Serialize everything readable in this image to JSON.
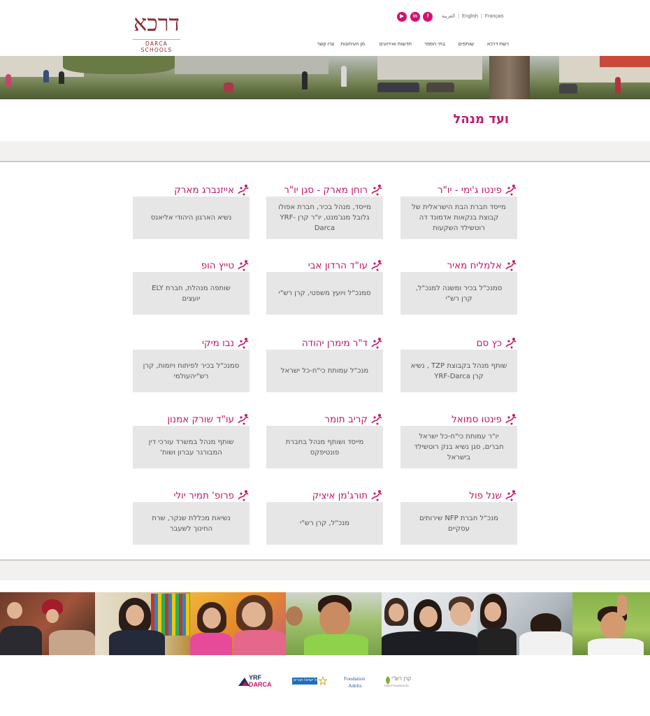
{
  "header": {
    "logo_hebrew": "דרכא",
    "logo_english": "DARCA SCHOOLS",
    "socials": [
      {
        "icon": "youtube-icon",
        "glyph": "▶"
      },
      {
        "icon": "linkedin-icon",
        "glyph": "in"
      },
      {
        "icon": "facebook-icon",
        "glyph": "f"
      }
    ],
    "languages": [
      "العربية",
      "English",
      "Français"
    ],
    "nav": [
      "רשת דרכא",
      "שותפים",
      "בתי הספר",
      "חדשות ואירועים",
      "מן העיתונות",
      "צרו קשר"
    ]
  },
  "page_title": "ועד מנהל",
  "colors": {
    "accent": "#c2186a",
    "card": "#e6e6e6",
    "band": "#f3f0f0"
  },
  "members": [
    {
      "name": "פינטו ג'ימי - יו\"ר",
      "desc": "מייסד חברת הבת הישראלית של קבוצת בנקאות אדמונד דה רוטשילד השקעות"
    },
    {
      "name": "רוחן מארק - סגן יו\"ר",
      "desc": "מייסד, מנהל בכיר, חברת אפולו גלובל מנג'מנט, יו\"ר קרן YRF-Darca"
    },
    {
      "name": "אייזנברג מארק",
      "desc": "נשיא הארגון היהודי אליאנס"
    },
    {
      "name": "אלמליח מאיר",
      "desc": "סמנכ\"ל בכיר ומשנה למנכ\"ל, קרן רש\"י"
    },
    {
      "name": "עו\"ד הרדון אבי",
      "desc": "סמנכ\"ל ויועץ משפטי, קרן רש\"י"
    },
    {
      "name": "טייץ הופ",
      "desc": "שותפה מנהלת, חברת ELY יועצים"
    },
    {
      "name": "כץ סם",
      "desc": "שותף מנהל בקבוצת TZP , נשיא קרן YRF-Darca"
    },
    {
      "name": "ד\"ר מימרן יהודה",
      "desc": "מנכ\"ל עמותת כי\"ח-כל ישראל"
    },
    {
      "name": "נבו מיקי",
      "desc": "סמנכ\"ל בכיר לפיתוח ויזמות, קרן רש\"יהעולמי"
    },
    {
      "name": "פינטו סמואל",
      "desc": "יו\"ר עמותת כי\"ח-כל ישראל חברים, סגן נשיא בנק רוטשילד בישראל"
    },
    {
      "name": "קריב תומר",
      "desc": "מייסד ושותף מנהל בחברת פונטיפקס"
    },
    {
      "name": "עו\"ד שורק אמנון",
      "desc": "שותף מנהל במשרד עורכי דין המבורגר עברון ושות'"
    },
    {
      "name": "שנל פול",
      "desc": "מנכ\"ל חברת NFP שירותים עסקיים"
    },
    {
      "name": "תורג'מן איציק",
      "desc": "מנכ\"ל, קרן רש\"י"
    },
    {
      "name": "פרופ' תמיר יולי",
      "desc": "נשיאת מכללת שנקר, שרת החינוך לשעבר"
    }
  ],
  "footer": {
    "partners": [
      {
        "icon": "yre-darca-logo",
        "line1": "YRF",
        "line2": "DARCA"
      },
      {
        "icon": "kol-israel-haverim-logo",
        "line1": "כל ישראל חברים"
      },
      {
        "icon": "fondation-adelis-logo",
        "line1": "Fondation",
        "line2": "Adelis"
      },
      {
        "icon": "rashi-foundation-logo",
        "line1": "קרן רש\"י",
        "line2": "RASHI FOUNDATION"
      }
    ]
  }
}
